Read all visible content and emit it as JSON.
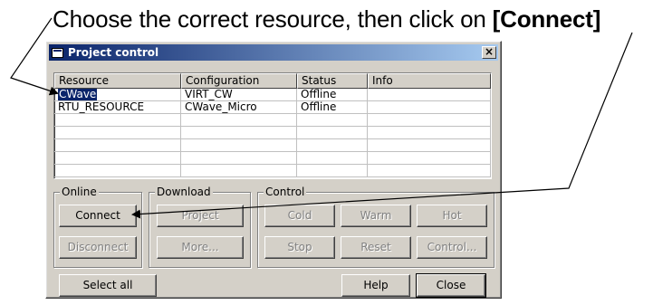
{
  "instruction": {
    "prefix": "Choose the correct resource, then click on ",
    "bold": "[Connect]"
  },
  "window": {
    "title": "Project control",
    "close_glyph": "×"
  },
  "table": {
    "columns": [
      "Resource",
      "Configuration",
      "Status",
      "Info"
    ],
    "rows": [
      {
        "resource": "CWave",
        "configuration": "VIRT_CW",
        "status": "Offline",
        "info": ""
      },
      {
        "resource": "RTU_RESOURCE",
        "configuration": "CWave_Micro",
        "status": "Offline",
        "info": ""
      }
    ],
    "selected_row": 0
  },
  "groups": {
    "online": "Online",
    "download": "Download",
    "control": "Control"
  },
  "buttons": {
    "connect": {
      "label": "Connect",
      "enabled": true
    },
    "disconnect": {
      "label": "Disconnect",
      "enabled": false
    },
    "project": {
      "label": "Project",
      "enabled": false
    },
    "more": {
      "label": "More...",
      "enabled": false
    },
    "cold": {
      "label": "Cold",
      "enabled": false
    },
    "warm": {
      "label": "Warm",
      "enabled": false
    },
    "hot": {
      "label": "Hot",
      "enabled": false
    },
    "stop": {
      "label": "Stop",
      "enabled": false
    },
    "reset": {
      "label": "Reset",
      "enabled": false
    },
    "control": {
      "label": "Control...",
      "enabled": false
    },
    "select_all": {
      "label": "Select all",
      "enabled": true
    },
    "help": {
      "label": "Help",
      "enabled": true
    },
    "close": {
      "label": "Close",
      "enabled": true
    }
  },
  "colors": {
    "title_gradient_start": "#0a246a",
    "title_gradient_end": "#a6caf0",
    "dialog_face": "#d4d0c8",
    "selection": "#0a246a"
  }
}
